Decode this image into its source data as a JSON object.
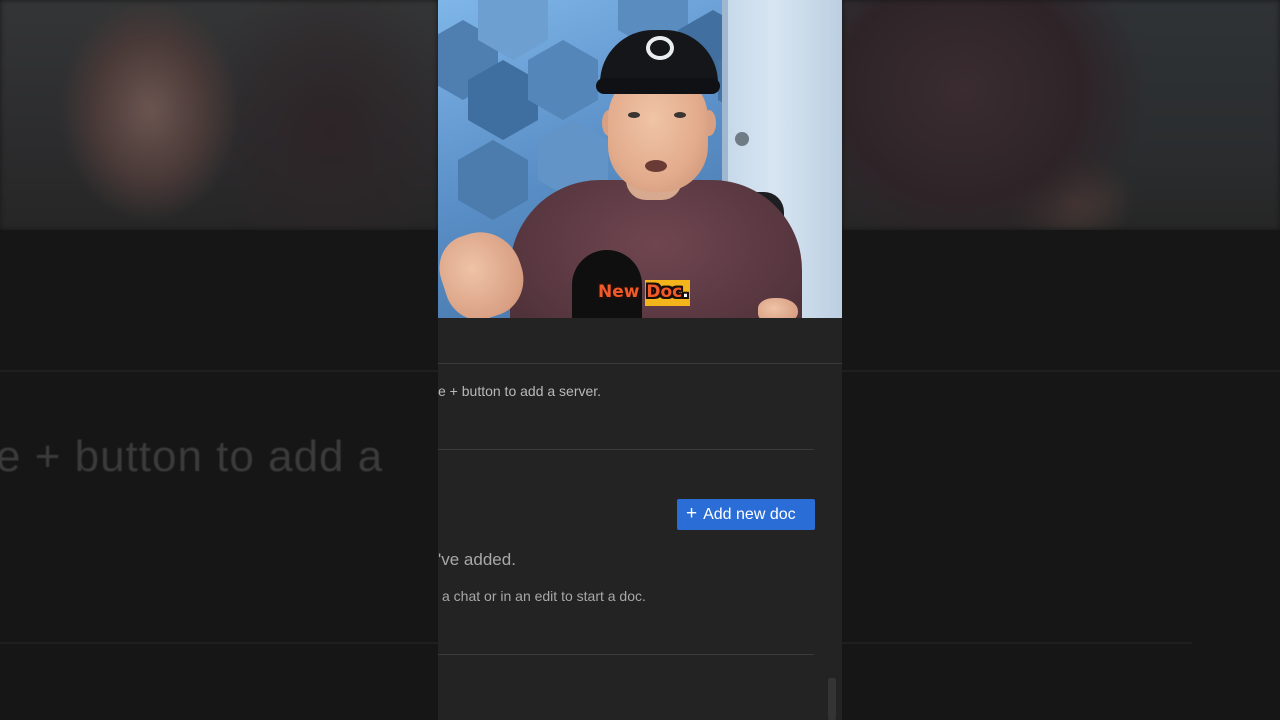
{
  "video": {
    "caption_word_1": "New",
    "caption_word_2": "Doc",
    "caption_punct": "."
  },
  "settings": {
    "servers_hint": "e + button to add a server.",
    "docs": {
      "add_button_label": "Add new doc",
      "add_button_icon": "plus-icon",
      "empty_title": "'ve added.",
      "empty_hint": "a chat or in an edit to start a doc."
    }
  },
  "background": {
    "zoomed_text": "e + button to add a"
  },
  "colors": {
    "button_accent": "#2a6dd6",
    "panel_bg": "#232323",
    "caption_text": "#f25a2a",
    "caption_highlight": "#f4b51c"
  }
}
